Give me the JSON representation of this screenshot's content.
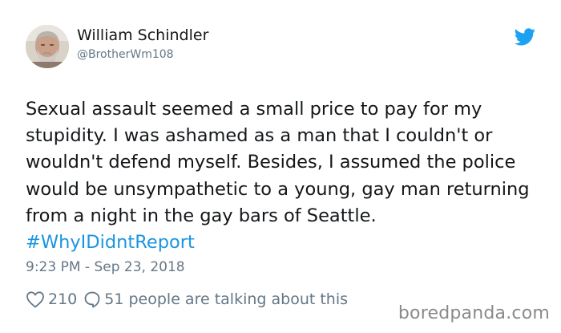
{
  "author": {
    "name": "William Schindler",
    "handle": "@BrotherWm108",
    "avatar_icon": "user-avatar-photo"
  },
  "brand": {
    "icon": "twitter-bird-icon",
    "color": "#1da1f2"
  },
  "tweet": {
    "text": "Sexual assault seemed a small price to pay for my stupidity. I was ashamed as a man that I couldn't or wouldn't defend myself. Besides, I assumed the police would be unsympathetic to a young, gay man returning from a night in the gay bars of Seattle.",
    "hashtag": "#WhyIDidntReport",
    "hashtag_color": "#1b95e0",
    "timestamp": "9:23 PM - Sep 23, 2018"
  },
  "engagement": {
    "likes": "210",
    "like_icon": "heart-outline-icon",
    "talking": "51 people are talking about this",
    "talking_icon": "speech-bubble-icon"
  },
  "watermark": "boredpanda.com"
}
